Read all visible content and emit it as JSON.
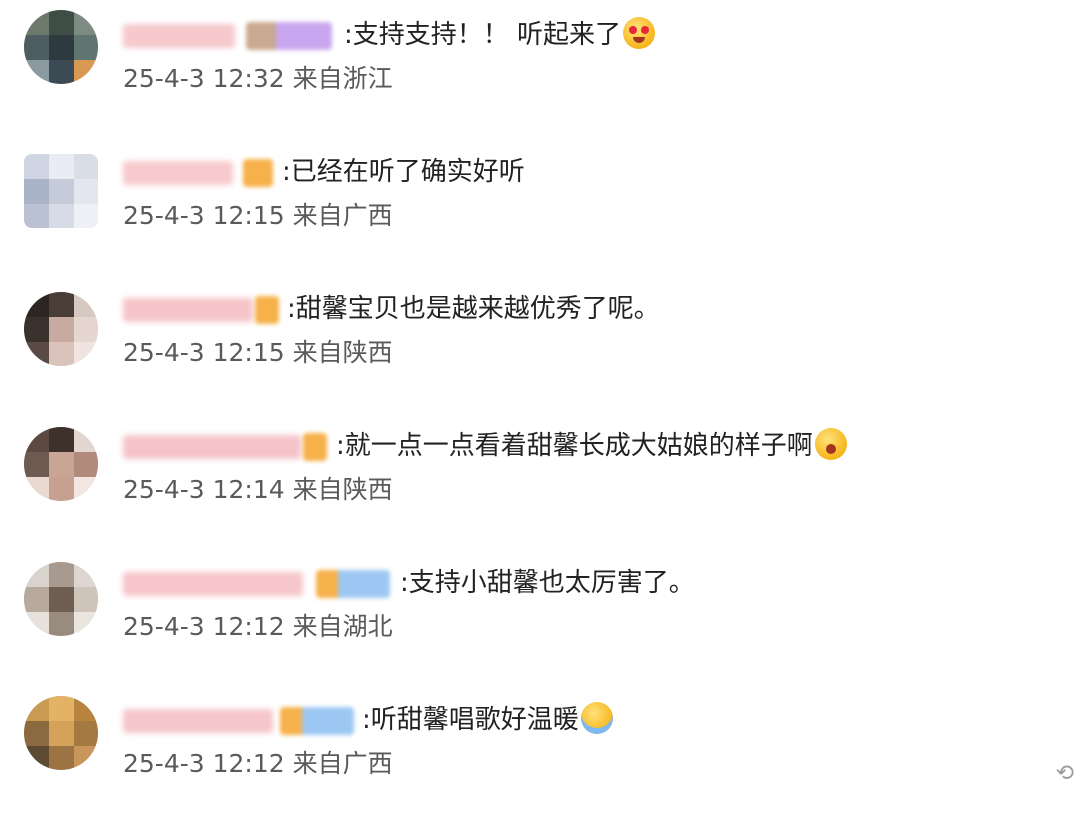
{
  "comments": [
    {
      "text": ":支持支持！！ 听起来了",
      "time": "25-4-3 12:32",
      "location": "来自浙江",
      "emoji": "heart-eyes-emoji"
    },
    {
      "text": ":已经在听了确实好听",
      "time": "25-4-3 12:15",
      "location": "来自广西",
      "emoji": ""
    },
    {
      "text": ":甜馨宝贝也是越来越优秀了呢。",
      "time": "25-4-3 12:15",
      "location": "来自陕西",
      "emoji": ""
    },
    {
      "text": ":就一点一点看着甜馨长成大姑娘的样子啊",
      "time": "25-4-3 12:14",
      "location": "来自陕西",
      "emoji": "flushed-emoji"
    },
    {
      "text": ":支持小甜馨也太厉害了。",
      "time": "25-4-3 12:12",
      "location": "来自湖北",
      "emoji": ""
    },
    {
      "text": ":听甜馨唱歌好温暖",
      "time": "25-4-3 12:12",
      "location": "来自广西",
      "emoji": "crying-emoji"
    }
  ],
  "colors": {
    "meta_text": "#5a5a5a",
    "name_blur": "#f3c1c4",
    "badge_orange": "#f6b14a",
    "badge_blue": "#9cc7f2",
    "badge_purple": "#c9a6f0"
  }
}
